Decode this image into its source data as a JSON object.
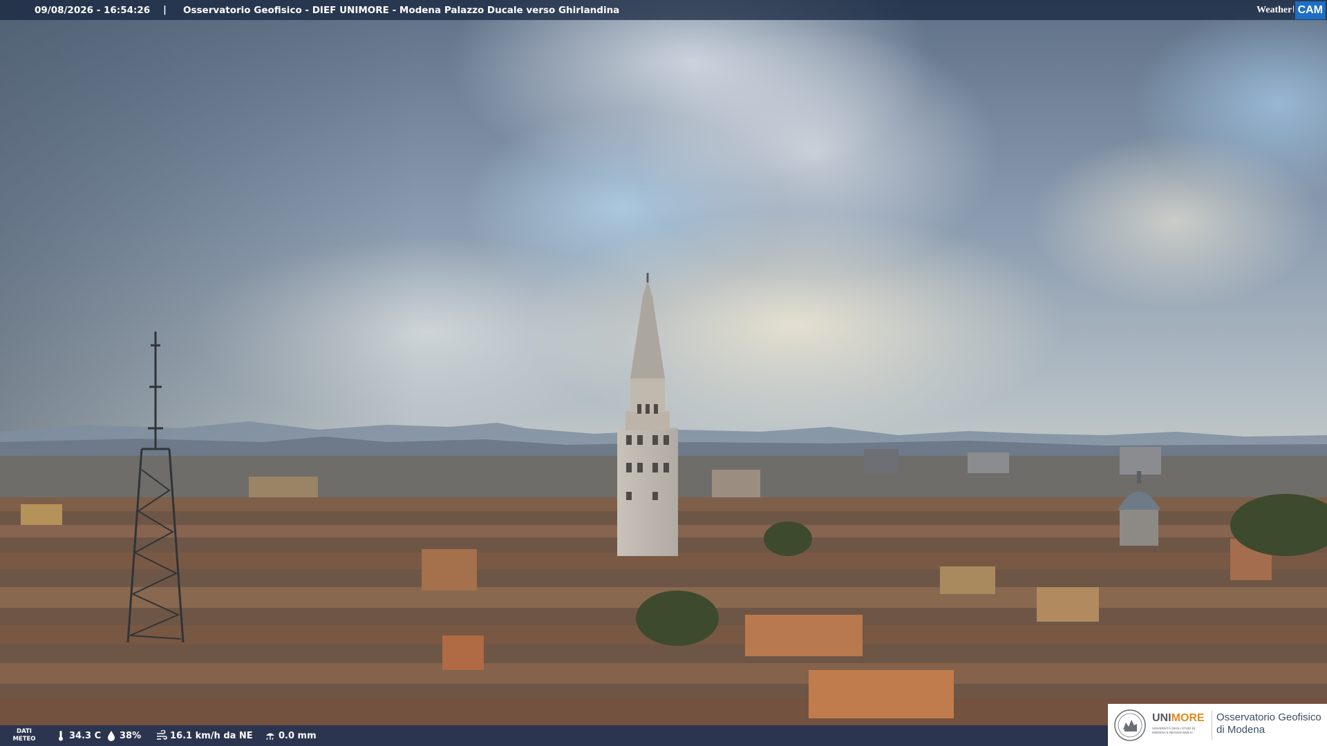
{
  "header": {
    "datetime": "09/08/2026 - 16:54:26",
    "separator": "|",
    "title": "Osservatorio Geofisico - DIEF UNIMORE - Modena Palazzo Ducale verso Ghirlandina",
    "brand": {
      "weather": "Weather",
      "cam": "CAM"
    }
  },
  "weather": {
    "label_line1": "DATI",
    "label_line2": "METEO",
    "temperature": "34.3 C",
    "humidity": "38%",
    "wind": "16.1 km/h da NE",
    "rain": "0.0 mm",
    "icons": [
      "thermometer-icon",
      "humidity-drop-icon",
      "wind-icon",
      "rain-icon"
    ]
  },
  "sponsor": {
    "uni_part1": "UNI",
    "uni_part2": "MORE",
    "uni_subtitle": "UNIVERSITÀ DEGLI STUDI DI MODENA E REGGIO EMILIA",
    "observatory_line1": "Osservatorio Geofisico",
    "observatory_line2": "di Modena"
  },
  "colors": {
    "accent_more": "#e08a1f",
    "cam_blue": "#1d6fc4",
    "bar_bg": "#102852"
  }
}
